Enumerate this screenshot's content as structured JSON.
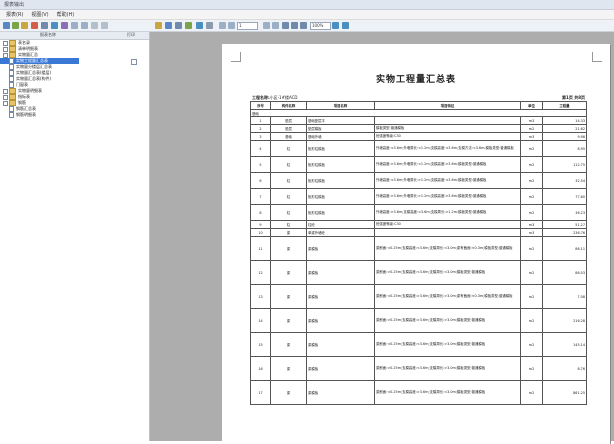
{
  "window": {
    "title": "报表输出"
  },
  "menu": [
    "报表(R)",
    "视图(V)",
    "帮助(H)"
  ],
  "toolbar": {
    "page_input": "1",
    "zoom": "100%"
  },
  "left_panel": {
    "col_name": "报表名称",
    "col_output": "打印",
    "tree": [
      {
        "indent": 0,
        "type": "folder",
        "exp": true,
        "label": "表名录",
        "checked": false,
        "sel": false
      },
      {
        "indent": 0,
        "type": "folder",
        "exp": true,
        "label": "清单明细表",
        "checked": false,
        "sel": false
      },
      {
        "indent": 0,
        "type": "folder",
        "exp": true,
        "label": "实物量汇总",
        "checked": false,
        "sel": false
      },
      {
        "indent": 1,
        "type": "doc",
        "exp": false,
        "label": "实物工程量汇总表",
        "checked": true,
        "sel": true
      },
      {
        "indent": 1,
        "type": "doc",
        "exp": false,
        "label": "实物量分楼层汇总表",
        "checked": false,
        "sel": false
      },
      {
        "indent": 1,
        "type": "doc",
        "exp": false,
        "label": "实物量汇总表(楼层)",
        "checked": false,
        "sel": false
      },
      {
        "indent": 1,
        "type": "doc",
        "exp": false,
        "label": "实物量汇总表(构件)",
        "checked": false,
        "sel": false
      },
      {
        "indent": 1,
        "type": "doc",
        "exp": false,
        "label": "门窗表",
        "checked": false,
        "sel": false
      },
      {
        "indent": 0,
        "type": "folder",
        "exp": true,
        "label": "实物量明细表",
        "checked": false,
        "sel": false
      },
      {
        "indent": 0,
        "type": "folder",
        "exp": true,
        "label": "指标表",
        "checked": false,
        "sel": false
      },
      {
        "indent": 0,
        "type": "folder",
        "exp": true,
        "label": "钢筋",
        "checked": false,
        "sel": false
      },
      {
        "indent": 1,
        "type": "doc",
        "exp": false,
        "label": "钢筋汇总表",
        "checked": false,
        "sel": false
      },
      {
        "indent": 1,
        "type": "doc",
        "exp": false,
        "label": "钢筋明细表",
        "checked": false,
        "sel": false
      }
    ]
  },
  "report": {
    "title": "实物工程量汇总表",
    "project_label": "工程名称:",
    "project_name": "小区-1#楼ACD",
    "page_info": "第1页 共8页",
    "headers": [
      "序号",
      "构件名称",
      "项目名称",
      "项目特征",
      "单位",
      "工程量"
    ],
    "group_label": "基础",
    "rows": [
      {
        "no": "1",
        "comp": "垫层",
        "item": "基础垫层平",
        "desc": "",
        "unit": "m3",
        "qty": "14.33",
        "h": 8
      },
      {
        "no": "2",
        "comp": "垫层",
        "item": "垫层模板",
        "desc": "模板类型:普通模板",
        "unit": "m2",
        "qty": "21.62",
        "h": 8
      },
      {
        "no": "3",
        "comp": "基础",
        "item": "基础外墙",
        "desc": "砼强度等级:C30",
        "unit": "m3",
        "qty": "9.98",
        "h": 8
      },
      {
        "no": "4",
        "comp": "柱",
        "item": "矩形柱模板",
        "desc": "外墙高度:<3.6m;外墙周长:<1.2m;支模高度:<3.6m;支模方法:<3.6m;模板类型:普通模板",
        "unit": "m2",
        "qty": "8.95",
        "h": 16
      },
      {
        "no": "5",
        "comp": "柱",
        "item": "矩形柱模板",
        "desc": "外墙高度:>3.6m;外墙周长:<1.2m;支模高度:>3.6m;模板类型:普通模板",
        "unit": "m2",
        "qty": "112.75",
        "h": 16
      },
      {
        "no": "6",
        "comp": "柱",
        "item": "矩形柱模板",
        "desc": "外墙高度:<3.6m;外墙周长:>1.2m;支模高度:<3.6m;模板类型:普通模板",
        "unit": "m2",
        "qty": "32.54",
        "h": 16
      },
      {
        "no": "7",
        "comp": "柱",
        "item": "矩形柱模板",
        "desc": "外墙高度:>3.6m;外墙周长:>1.2m;支模高度:>3.6m;模板类型:普通模板",
        "unit": "m2",
        "qty": "77.60",
        "h": 16
      },
      {
        "no": "8",
        "comp": "柱",
        "item": "矩形柱模板",
        "desc": "外墙高度:>3.6m;支模高度:<3.6m;支模周长:>1.2m;模板类型:普通模板",
        "unit": "m2",
        "qty": "36.23",
        "h": 16
      },
      {
        "no": "9",
        "comp": "柱",
        "item": "柱砼",
        "desc": "砼强度等级:C30",
        "unit": "m3",
        "qty": "51.27",
        "h": 8
      },
      {
        "no": "10",
        "comp": "梁",
        "item": "单梁外墙砼",
        "desc": "",
        "unit": "m3",
        "qty": "236.76",
        "h": 8
      },
      {
        "no": "11",
        "comp": "梁",
        "item": "梁模板",
        "desc": "梁断面:<0.25m;支模高度:<3.6m;支模周长:<3.0m;梁有截面:<0.3m;模板类型:普通模板",
        "unit": "m2",
        "qty": "86.11",
        "h": 24
      },
      {
        "no": "12",
        "comp": "梁",
        "item": "梁模板",
        "desc": "梁断面:>0.25m;支模高度:<3.6m;支模周长:<3.0m;模板类型:普通模板",
        "unit": "m2",
        "qty": "86.03",
        "h": 24
      },
      {
        "no": "13",
        "comp": "梁",
        "item": "梁模板",
        "desc": "梁断面:<0.25m;支模高度:>3.6m;支模周长:>3.0m;梁有截面:<0.3m;模板类型:普通模板",
        "unit": "m2",
        "qty": "7.08",
        "h": 24
      },
      {
        "no": "14",
        "comp": "梁",
        "item": "梁模板",
        "desc": "梁断面:>0.25m;支模高度:>3.6m;支模周长:>3.0m;模板类型:普通模板",
        "unit": "m2",
        "qty": "216.28",
        "h": 24
      },
      {
        "no": "15",
        "comp": "梁",
        "item": "梁模板",
        "desc": "梁断面:<0.25m;支模高度:<3.6m;支模周长:>3.0m;模板类型:普通模板",
        "unit": "m2",
        "qty": "145.14",
        "h": 24
      },
      {
        "no": "16",
        "comp": "梁",
        "item": "梁模板",
        "desc": "梁断面:>0.25m;支模高度:<3.6m;支模周长:>3.0m;模板类型:普通模板",
        "unit": "m2",
        "qty": "8.76",
        "h": 24
      },
      {
        "no": "17",
        "comp": "梁",
        "item": "梁模板",
        "desc": "梁断面:<0.25m;支模高度:>3.6m;支模周长:<3.0m;模板类型:普通模板",
        "unit": "m2",
        "qty": "861.25",
        "h": 24
      }
    ]
  }
}
